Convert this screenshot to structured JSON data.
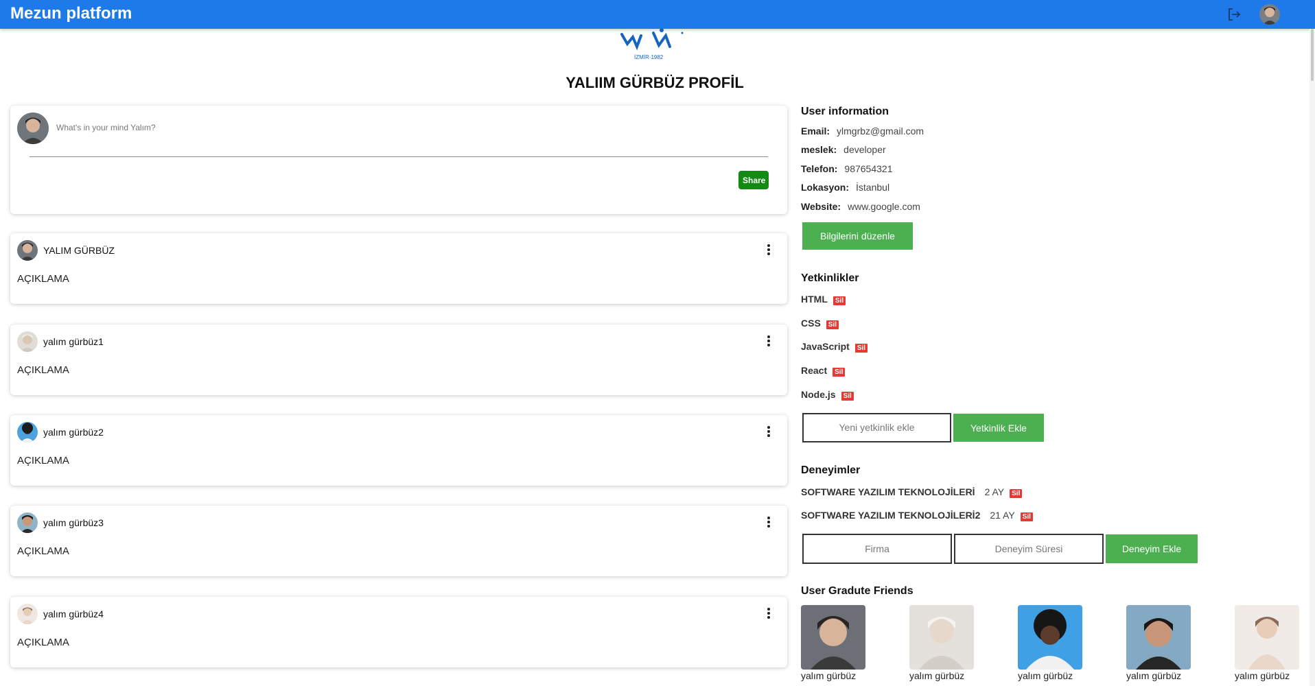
{
  "appbar": {
    "brand": "Mezun platform",
    "logout_icon": "logout-icon",
    "avatar_icon": "user-avatar"
  },
  "logo": {
    "caption": "İZMİR·1982"
  },
  "page_title": "YALIIM GÜRBÜZ PROFİL",
  "composer": {
    "placeholder": "What's in your mind Yalım?",
    "share_label": "Share"
  },
  "posts": [
    {
      "author": "YALIM GÜRBÜZ",
      "description": "AÇIKLAMA"
    },
    {
      "author": "yalım gürbüz1",
      "description": "AÇIKLAMA"
    },
    {
      "author": "yalım gürbüz2",
      "description": "AÇIKLAMA"
    },
    {
      "author": "yalım gürbüz3",
      "description": "AÇIKLAMA"
    },
    {
      "author": "yalım gürbüz4",
      "description": "AÇIKLAMA"
    }
  ],
  "user_info": {
    "title": "User information",
    "rows": [
      {
        "key": "Email:",
        "value": "ylmgrbz@gmail.com"
      },
      {
        "key": "meslek:",
        "value": "developer"
      },
      {
        "key": "Telefon:",
        "value": "987654321"
      },
      {
        "key": "Lokasyon:",
        "value": "İstanbul"
      },
      {
        "key": "Website:",
        "value": "www.google.com"
      }
    ],
    "edit_label": "Bilgilerini düzenle"
  },
  "skills": {
    "title": "Yetkinlikler",
    "items": [
      "HTML",
      "CSS",
      "JavaScript",
      "React",
      "Node.js"
    ],
    "delete_label": "Sil",
    "input_placeholder": "Yeni yetkinlik ekle",
    "add_label": "Yetkinlik Ekle"
  },
  "experiences": {
    "title": "Deneyimler",
    "items": [
      {
        "company": "SOFTWARE YAZILIM TEKNOLOJİLERİ",
        "duration": "2 AY"
      },
      {
        "company": "SOFTWARE YAZILIM TEKNOLOJİLERİ2",
        "duration": "21 AY"
      }
    ],
    "delete_label": "Sil",
    "company_placeholder": "Firma",
    "duration_placeholder": "Deneyim Süresi",
    "add_label": "Deneyim Ekle"
  },
  "friends": {
    "title": "User Gradute Friends",
    "items": [
      "yalım gürbüz",
      "yalım gürbüz",
      "yalım gürbüz",
      "yalım gürbüz",
      "yalım gürbüz"
    ]
  },
  "colors": {
    "appbar": "#1e7ae9",
    "share": "#138a13",
    "green": "#4caf50",
    "danger": "#e53935"
  }
}
